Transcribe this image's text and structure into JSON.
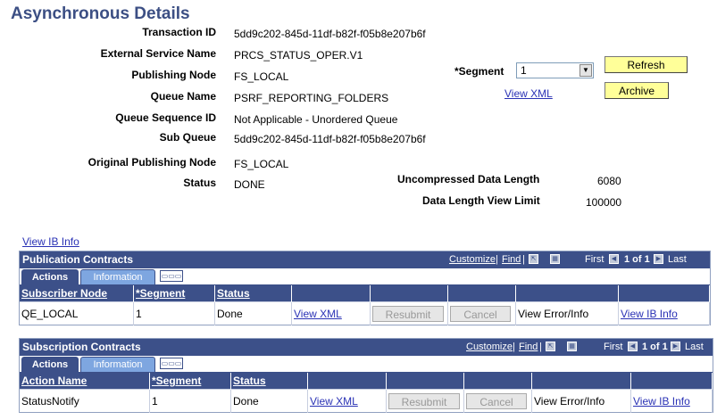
{
  "page": {
    "title": "Asynchronous Details"
  },
  "fields": [
    {
      "label": "Transaction ID",
      "value": "5dd9c202-845d-11df-b82f-f05b8e207b6f"
    },
    {
      "label": "External Service Name",
      "value": "PRCS_STATUS_OPER.V1"
    },
    {
      "label": "Publishing Node",
      "value": "FS_LOCAL"
    },
    {
      "label": "Queue Name",
      "value": "PSRF_REPORTING_FOLDERS"
    },
    {
      "label": "Queue Sequence ID",
      "value": "Not Applicable - Unordered Queue"
    },
    {
      "label": "Sub Queue",
      "value": "5dd9c202-845d-11df-b82f-f05b8e207b6f"
    },
    {
      "label": "Original Publishing Node",
      "value": "FS_LOCAL"
    },
    {
      "label": "Status",
      "value": "DONE"
    }
  ],
  "segment": {
    "label": "*Segment",
    "value": "1"
  },
  "view_xml_label": "View XML",
  "buttons": {
    "refresh": "Refresh",
    "archive": "Archive"
  },
  "data_length": {
    "uncompressed_label": "Uncompressed Data Length",
    "uncompressed_value": "6080",
    "limit_label": "Data Length View Limit",
    "limit_value": "100000"
  },
  "view_ib_info_label": "View IB Info",
  "grid_nav": {
    "customize": "Customize",
    "sep": "|",
    "find": "Find",
    "first": "First",
    "count": "1 of 1",
    "last": "Last"
  },
  "publication": {
    "title": "Publication Contracts",
    "tabs": [
      "Actions",
      "Information"
    ],
    "columns": [
      "Subscriber Node",
      "*Segment",
      "Status"
    ],
    "row": {
      "col1": "QE_LOCAL",
      "segment": "1",
      "status": "Done",
      "view_xml": "View XML",
      "resubmit": "Resubmit",
      "cancel": "Cancel",
      "error": "View Error/Info",
      "ib_info": "View IB Info"
    }
  },
  "subscription": {
    "title": "Subscription Contracts",
    "tabs": [
      "Actions",
      "Information"
    ],
    "columns": [
      "Action Name",
      "*Segment",
      "Status"
    ],
    "row": {
      "col1": "StatusNotify",
      "segment": "1",
      "status": "Done",
      "view_xml": "View XML",
      "resubmit": "Resubmit",
      "cancel": "Cancel",
      "error": "View Error/Info",
      "ib_info": "View IB Info"
    }
  }
}
